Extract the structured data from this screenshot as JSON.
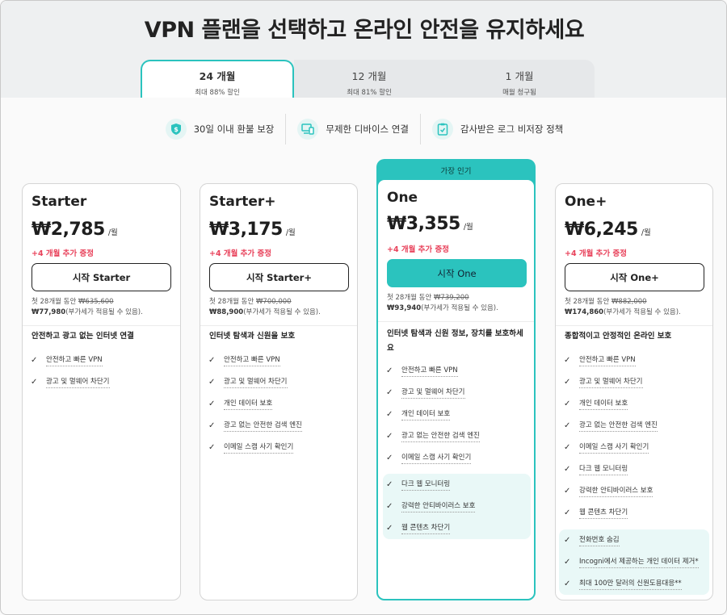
{
  "title": "VPN 플랜을 선택하고 온라인 안전을 유지하세요",
  "tabs": [
    {
      "label": "24 개월",
      "sub": "최대 88% 할인"
    },
    {
      "label": "12 개월",
      "sub": "최대 81% 할인"
    },
    {
      "label": "1 개월",
      "sub": "매월 청구됨"
    }
  ],
  "features": [
    {
      "icon": "dollar-shield-icon",
      "label": "30일 이내 환불 보장"
    },
    {
      "icon": "devices-icon",
      "label": "무제한 디바이스 연결"
    },
    {
      "icon": "audit-doc-icon",
      "label": "감사받은 로그 비저장 정책"
    }
  ],
  "popular_badge": "가장 인기",
  "plans": [
    {
      "name": "Starter",
      "price": "₩2,785",
      "per": "/월",
      "bonus": "+4 개월 추가 증정",
      "cta": "시작 Starter",
      "billing_prefix": "첫 28개월 동안 ",
      "billing_old": "₩635,600",
      "billing_new": "₩77,980",
      "billing_note": "(부가세가 적용될 수 있음).",
      "desc": "안전하고 광고 없는 인터넷 연결",
      "items": [
        "안전하고 빠른 VPN",
        "광고 및 멀웨어 차단기"
      ],
      "extra": []
    },
    {
      "name": "Starter+",
      "price": "₩3,175",
      "per": "/월",
      "bonus": "+4 개월 추가 증정",
      "cta": "시작 Starter+",
      "billing_prefix": "첫 28개월 동안 ",
      "billing_old": "₩700,000",
      "billing_new": "₩88,900",
      "billing_note": "(부가세가 적용될 수 있음).",
      "desc": "인터넷 탐색과 신원을 보호",
      "items": [
        "안전하고 빠른 VPN",
        "광고 및 멀웨어 차단기",
        "개인 데이터 보호",
        "광고 없는 안전한 검색 엔진",
        "이메일 스캠 사기 확인기"
      ],
      "extra": []
    },
    {
      "name": "One",
      "price": "₩3,355",
      "per": "/월",
      "bonus": "+4 개월 추가 증정",
      "cta": "시작 One",
      "billing_prefix": "첫 28개월 동안 ",
      "billing_old": "₩739,200",
      "billing_new": "₩93,940",
      "billing_note": "(부가세가 적용될 수 있음).",
      "desc": "인터넷 탐색과 신원 정보, 장치를 보호하세요",
      "items": [
        "안전하고 빠른 VPN",
        "광고 및 멀웨어 차단기",
        "개인 데이터 보호",
        "광고 없는 안전한 검색 엔진",
        "이메일 스캠 사기 확인기"
      ],
      "extra": [
        "다크 웹 모니터링",
        "강력한 안티바이러스 보호",
        "웹 콘텐츠 차단기"
      ]
    },
    {
      "name": "One+",
      "price": "₩6,245",
      "per": "/월",
      "bonus": "+4 개월 추가 증정",
      "cta": "시작 One+",
      "billing_prefix": "첫 28개월 동안 ",
      "billing_old": "₩882,000",
      "billing_new": "₩174,860",
      "billing_note": "(부가세가 적용될 수 있음).",
      "desc": "종합적이고 안정적인 온라인 보호",
      "items": [
        "안전하고 빠른 VPN",
        "광고 및 멀웨어 차단기",
        "개인 데이터 보호",
        "광고 없는 안전한 검색 엔진",
        "이메일 스캠 사기 확인기",
        "다크 웹 모니터링",
        "강력한 안티바이러스 보호",
        "웹 콘텐츠 차단기"
      ],
      "extra": [
        "전화번호 숨김",
        "Incogni에서 제공하는 개인 데이터 제거*",
        "최대 100만 달러의 신원도용대응**"
      ]
    }
  ],
  "colors": {
    "accent": "#2bc3be",
    "bonus": "#e8415a",
    "extra_bg": "#e9f8f7"
  }
}
